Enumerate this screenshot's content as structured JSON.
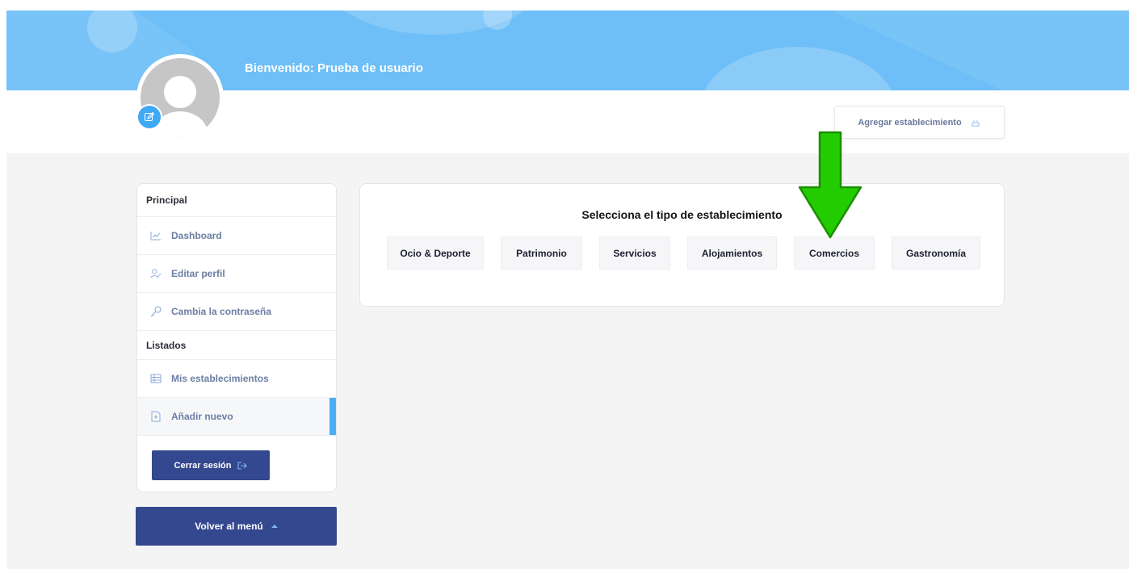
{
  "header": {
    "welcome": "Bienvenido: Prueba de usuario",
    "add_establishment": "Agregar establecimiento",
    "banner_color": "#6ebff7"
  },
  "sidebar": {
    "section_main": "Principal",
    "items_main": [
      {
        "label": "Dashboard",
        "icon": "chart-line-icon"
      },
      {
        "label": "Editar perfil",
        "icon": "user-edit-icon"
      },
      {
        "label": "Cambia la contraseña",
        "icon": "key-icon"
      }
    ],
    "section_lists": "Listados",
    "items_lists": [
      {
        "label": "Mis establecimientos",
        "icon": "table-icon"
      },
      {
        "label": "Añadir nuevo",
        "icon": "file-plus-icon",
        "active": true
      }
    ],
    "logout": "Cerrar sesión",
    "back_menu": "Volver al menú",
    "accent_color": "#4aaff5",
    "button_color": "#34488f"
  },
  "main": {
    "title": "Selecciona el tipo de establecimiento",
    "types": [
      "Ocio & Deporte",
      "Patrimonio",
      "Servicios",
      "Alojamientos",
      "Comercios",
      "Gastronomía"
    ]
  },
  "annotation": {
    "arrow_color": "#22cc00"
  }
}
